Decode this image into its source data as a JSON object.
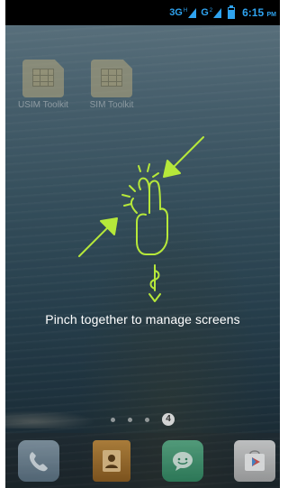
{
  "status_bar": {
    "network_1": {
      "label": "3G",
      "superscript": "H"
    },
    "network_2": {
      "label": "G",
      "superscript": "2"
    },
    "time": "6:15",
    "ampm": "PM"
  },
  "home_apps": [
    {
      "label": "USIM Toolkit",
      "icon": "sim-card-icon"
    },
    {
      "label": "SIM Toolkit",
      "icon": "sim-card-icon"
    }
  ],
  "hint": {
    "text": "Pinch together to manage screens"
  },
  "pager": {
    "current_page": "4"
  },
  "dock": [
    {
      "app": "Phone",
      "icon": "phone-icon"
    },
    {
      "app": "Contacts",
      "icon": "contacts-icon"
    },
    {
      "app": "Messaging",
      "icon": "messaging-icon"
    },
    {
      "app": "Play Store",
      "icon": "play-store-icon"
    }
  ],
  "colors": {
    "status_accent": "#2fa3ef",
    "gesture_green": "#b6e83a",
    "hint_text": "#ffffff"
  }
}
